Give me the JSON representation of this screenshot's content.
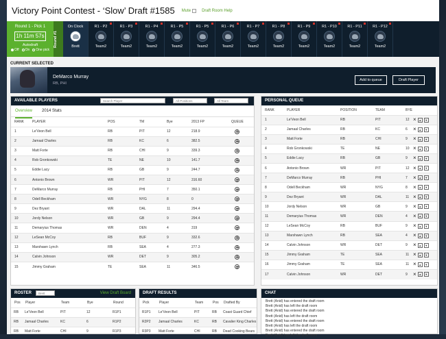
{
  "header": {
    "title": "Victory Point Contest - ‘Slow’ Draft #1585",
    "mute_label": "Mute",
    "help_label": "Draft Room Help"
  },
  "clock": {
    "round_pick": "Round 1 - Pick 1",
    "timer": "1h 11m 57s",
    "autodraft_label": "Autodraft",
    "options": [
      "Off",
      "On",
      "One pick"
    ],
    "selected_option": "Off",
    "round_label": "Round #1"
  },
  "slots": [
    {
      "label": "On Clock",
      "team": "Brett",
      "current": true
    },
    {
      "label": "R1 - P2",
      "team": "Team2"
    },
    {
      "label": "R1 - P3",
      "team": "Team2"
    },
    {
      "label": "R1 - P4",
      "team": "Team2"
    },
    {
      "label": "R1 - P5",
      "team": "Team2"
    },
    {
      "label": "R1 - P5",
      "team": "Team2"
    },
    {
      "label": "R1 - P6",
      "team": "Team2"
    },
    {
      "label": "R1 - P7",
      "team": "Team2"
    },
    {
      "label": "R1 - P8",
      "team": "Team2"
    },
    {
      "label": "R1 - P9",
      "team": "Team2"
    },
    {
      "label": "R1 - P10",
      "team": "Team2"
    },
    {
      "label": "R1 - P11",
      "team": "Team2"
    },
    {
      "label": "R1 - P12",
      "team": "Team2"
    }
  ],
  "current": {
    "section_label": "CURRENT SELECTED",
    "name": "DeMarco Murray",
    "sub": "RB, PHI",
    "add_label": "Add to queue",
    "draft_label": "Draft Player"
  },
  "available": {
    "title": "AVAILABLE PLAYERS",
    "search_placeholder": "Search Player",
    "positions_label": "All Positions",
    "teams_label": "All Team",
    "tabs": [
      "Overview",
      "2014 Stats"
    ],
    "columns": [
      "RANK",
      "PLAYER",
      "POS",
      "TM",
      "Bye",
      "2013 FP",
      "QUEUE"
    ],
    "rows": [
      [
        "1",
        "Le'Veon Bell",
        "RB",
        "PIT",
        "12",
        "218.9"
      ],
      [
        "2",
        "Jamaal Charles",
        "RB",
        "KC",
        "6",
        "382.5"
      ],
      [
        "3",
        "Matt Forte",
        "RB",
        "CHI",
        "9",
        "339.3"
      ],
      [
        "4",
        "Rob Gronkowski",
        "TE",
        "NE",
        "10",
        "141.7"
      ],
      [
        "5",
        "Eddie Lacy",
        "RB",
        "GB",
        "9",
        "244.7"
      ],
      [
        "6",
        "Antonio Brown",
        "WR",
        "PIT",
        "12",
        "316.60"
      ],
      [
        "7",
        "DeMarco Murray",
        "RB",
        "PHI",
        "7",
        "350.1"
      ],
      [
        "8",
        "Odell Beckham",
        "WR",
        "NYG",
        "8",
        "0"
      ],
      [
        "9",
        "Dez Bryant",
        "WR",
        "DAL",
        "11",
        "294.4"
      ],
      [
        "10",
        "Jordy Nelson",
        "WR",
        "GB",
        "9",
        "294.4"
      ],
      [
        "11",
        "Demaryius Thomas",
        "WR",
        "DEN",
        "4",
        "319"
      ],
      [
        "12",
        "LeSean McCoy",
        "RB",
        "BUF",
        "9",
        "332.6"
      ],
      [
        "13",
        "Marshawn Lynch",
        "RB",
        "SEA",
        "4",
        "277.3"
      ],
      [
        "14",
        "Calvin Johnson",
        "WR",
        "DET",
        "9",
        "305.2"
      ],
      [
        "15",
        "Jimmy Graham",
        "TE",
        "SEA",
        "11",
        "346.5"
      ]
    ]
  },
  "queue": {
    "title": "PERSONAL QUEUE",
    "columns": [
      "RANK",
      "PLAYER",
      "POSITION",
      "TEAM",
      "BYE"
    ],
    "rows": [
      [
        "1",
        "Le'Veon Bell",
        "RB",
        "PIT",
        "12"
      ],
      [
        "2",
        "Jamaal Charles",
        "RB",
        "KC",
        "6"
      ],
      [
        "3",
        "Matt Forte",
        "RB",
        "CHI",
        "9"
      ],
      [
        "4",
        "Rob Gronkowski",
        "TE",
        "NE",
        "10"
      ],
      [
        "5",
        "Eddie Lacy",
        "RB",
        "GB",
        "9"
      ],
      [
        "6",
        "Antonio Brown",
        "WR",
        "PIT",
        "12"
      ],
      [
        "7",
        "DeMarco Murray",
        "RB",
        "PHI",
        "7"
      ],
      [
        "8",
        "Odell Beckham",
        "WR",
        "NYG",
        "8"
      ],
      [
        "9",
        "Dez Bryant",
        "WR",
        "DAL",
        "11"
      ],
      [
        "10",
        "Jordy Nelson",
        "WR",
        "GB",
        "9"
      ],
      [
        "11",
        "Demaryius Thomas",
        "WR",
        "DEN",
        "4"
      ],
      [
        "12",
        "LeSean McCoy",
        "RB",
        "BUF",
        "9"
      ],
      [
        "13",
        "Marshawn Lynch",
        "RB",
        "SEA",
        "4"
      ],
      [
        "14",
        "Calvin Johnson",
        "WR",
        "DET",
        "9"
      ],
      [
        "15",
        "Jimmy Graham",
        "TE",
        "SEA",
        "11"
      ],
      [
        "16",
        "Jimmy Graham",
        "TE",
        "SEA",
        "11"
      ],
      [
        "17",
        "Calvin Johnson",
        "WR",
        "DET",
        "9"
      ]
    ]
  },
  "roster": {
    "title": "ROSTER",
    "team_select": "Brett",
    "view_board": "View Draft Board",
    "columns": [
      "Pos",
      "Player",
      "Team",
      "Bye",
      "Round"
    ],
    "rows": [
      [
        "RB",
        "Le'Veon Bell",
        "PIT",
        "12",
        "R1P1"
      ],
      [
        "RB",
        "Jamaal Charles",
        "KC",
        "6",
        "R1P2"
      ],
      [
        "RB",
        "Matt Forte",
        "CHI",
        "9",
        "R1P3"
      ]
    ]
  },
  "results": {
    "title": "DRAFT RESULTS",
    "columns": [
      "Pick",
      "Player",
      "Team",
      "Pos",
      "Drafted By"
    ],
    "rows": [
      [
        "R1P1",
        "Le'Veon Bell",
        "PIT",
        "RB",
        "Coast Guard Chief"
      ],
      [
        "R2P2",
        "Jamaal Charles",
        "KC",
        "RB",
        "Cavalier King Charles"
      ],
      [
        "R3P3",
        "Matt Forte",
        "CHI",
        "RB",
        "Dead Cooking Bears"
      ]
    ]
  },
  "chat": {
    "title": "CHAT",
    "lines": [
      "Brett (Anid) has entered the draft room",
      "Brett (Anid) has left the draft room",
      "Brett (Anid) has entered the draft room",
      "Brett (Anid) has left the draft room",
      "Brett (Anid) has entered the draft room",
      "Brett (Anid) has left the draft room",
      "Brett (Anid) has entered the draft room",
      "Brett (Anid) has left the draft room"
    ]
  }
}
